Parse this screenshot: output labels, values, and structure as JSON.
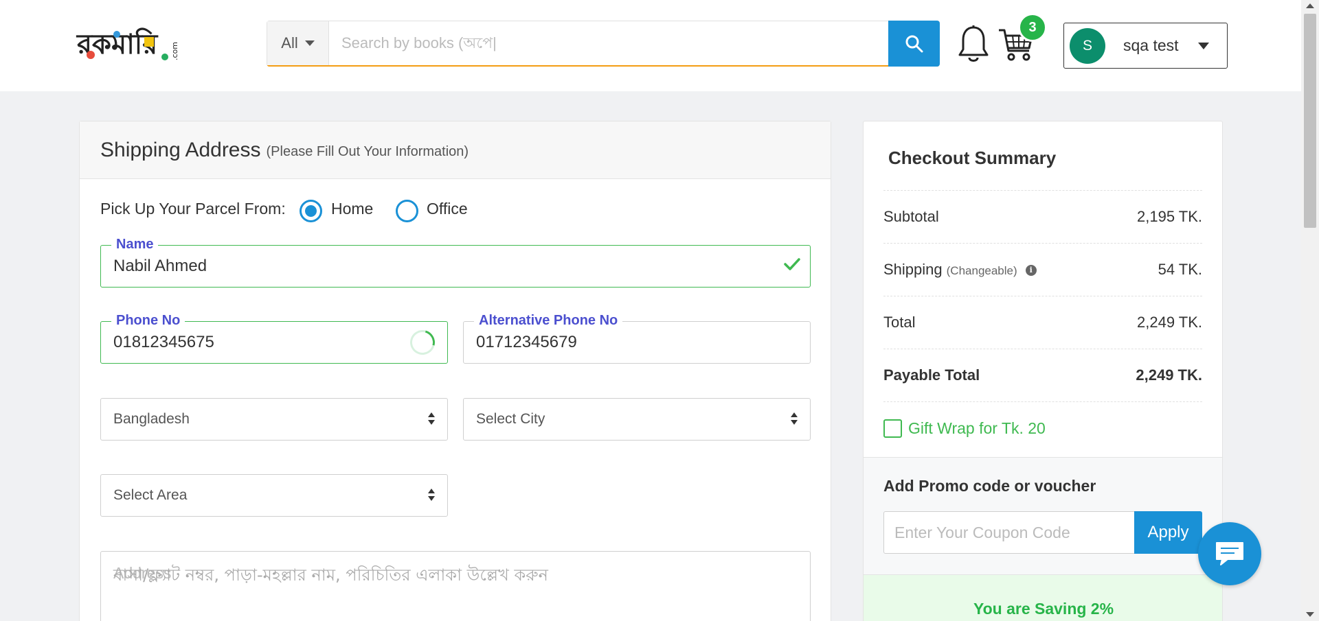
{
  "header": {
    "logo_text": "রকমারি.com",
    "search": {
      "category": "All",
      "placeholder": "Search by books (অপে|"
    },
    "cart_count": "3",
    "user": {
      "initial": "S",
      "name": "sqa test"
    }
  },
  "shipping": {
    "title": "Shipping Address",
    "subtitle": "(Please Fill Out Your Information)",
    "pickup_label": "Pick Up Your Parcel From:",
    "options": [
      "Home",
      "Office"
    ],
    "selected_option": "Home",
    "name": {
      "label": "Name",
      "value": "Nabil Ahmed"
    },
    "phone": {
      "label": "Phone No",
      "value": "01812345675"
    },
    "alt_phone": {
      "label": "Alternative Phone No",
      "value": "01712345679"
    },
    "country": "Bangladesh",
    "city": "Select City",
    "area": "Select Area",
    "address": {
      "label": "Address",
      "placeholder": "বাসা/ফ্ল্যাট নম্বর, পাড়া-মহল্লার নাম, পরিচিতির এলাকা উল্লেখ করুন"
    }
  },
  "summary": {
    "title": "Checkout Summary",
    "subtotal": {
      "label": "Subtotal",
      "value": "2,195 TK."
    },
    "shipping": {
      "label": "Shipping",
      "note": "(Changeable)",
      "value": "54 TK."
    },
    "total": {
      "label": "Total",
      "value": "2,249 TK."
    },
    "payable": {
      "label": "Payable Total",
      "value": "2,249 TK."
    },
    "gift_wrap": "Gift Wrap for Tk. 20",
    "promo_title": "Add Promo code or voucher",
    "coupon_placeholder": "Enter Your Coupon Code",
    "apply_label": "Apply",
    "saving_text": "You are Saving 2%"
  },
  "colors": {
    "brand_blue": "#1a91d6",
    "success_green": "#27b449",
    "legend_purple": "#4b4fcf",
    "search_underline": "#f39c12"
  }
}
